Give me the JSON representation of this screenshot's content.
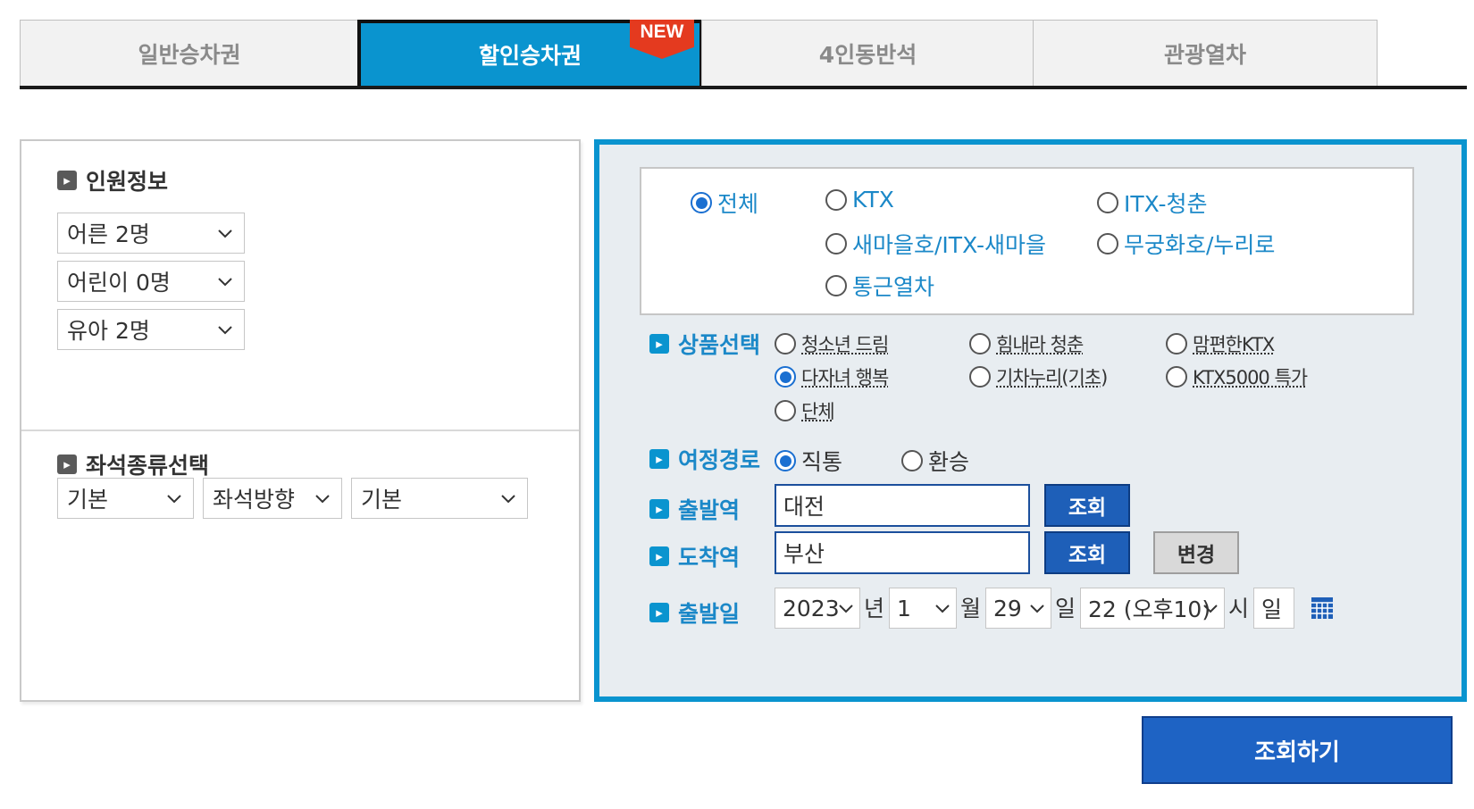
{
  "tabs": [
    {
      "label": "일반승차권"
    },
    {
      "label": "할인승차권",
      "badge": "NEW"
    },
    {
      "label": "4인동반석"
    },
    {
      "label": "관광열차"
    }
  ],
  "passenger": {
    "title": "인원정보",
    "adult": "어른 2명",
    "child": "어린이 0명",
    "infant": "유아 2명"
  },
  "seat": {
    "title": "좌석종류선택",
    "type": "기본",
    "direction": "좌석방향",
    "option": "기본"
  },
  "train_types": {
    "all": "전체",
    "ktx": "KTX",
    "itx_saemaeul": "새마을호/ITX-새마을",
    "itx_cheongchun": "ITX-청춘",
    "mugunghwa": "무궁화호/누리로",
    "commuter": "통근열차"
  },
  "product": {
    "label": "상품선택",
    "items": [
      "청소년 드림",
      "힘내라 청춘",
      "맘편한KTX",
      "다자녀 행복",
      "기차누리(기초)",
      "KTX5000 특가",
      "단체"
    ]
  },
  "route": {
    "label": "여정경로",
    "direct": "직통",
    "transfer": "환승"
  },
  "departure": {
    "label": "출발역",
    "value": "대전",
    "search_btn": "조회"
  },
  "arrival": {
    "label": "도착역",
    "value": "부산",
    "search_btn": "조회",
    "swap_btn": "변경"
  },
  "date": {
    "label": "출발일",
    "year": "2023",
    "year_unit": "년",
    "month": "1",
    "month_unit": "월",
    "day": "29",
    "day_unit": "일",
    "hour": "22 (오후10)",
    "hour_unit": "시",
    "weekday": "일"
  },
  "submit_label": "조회하기",
  "colors": {
    "accent": "#0a94cf",
    "button_blue": "#1e5fb8",
    "badge_red": "#e43a1f"
  }
}
